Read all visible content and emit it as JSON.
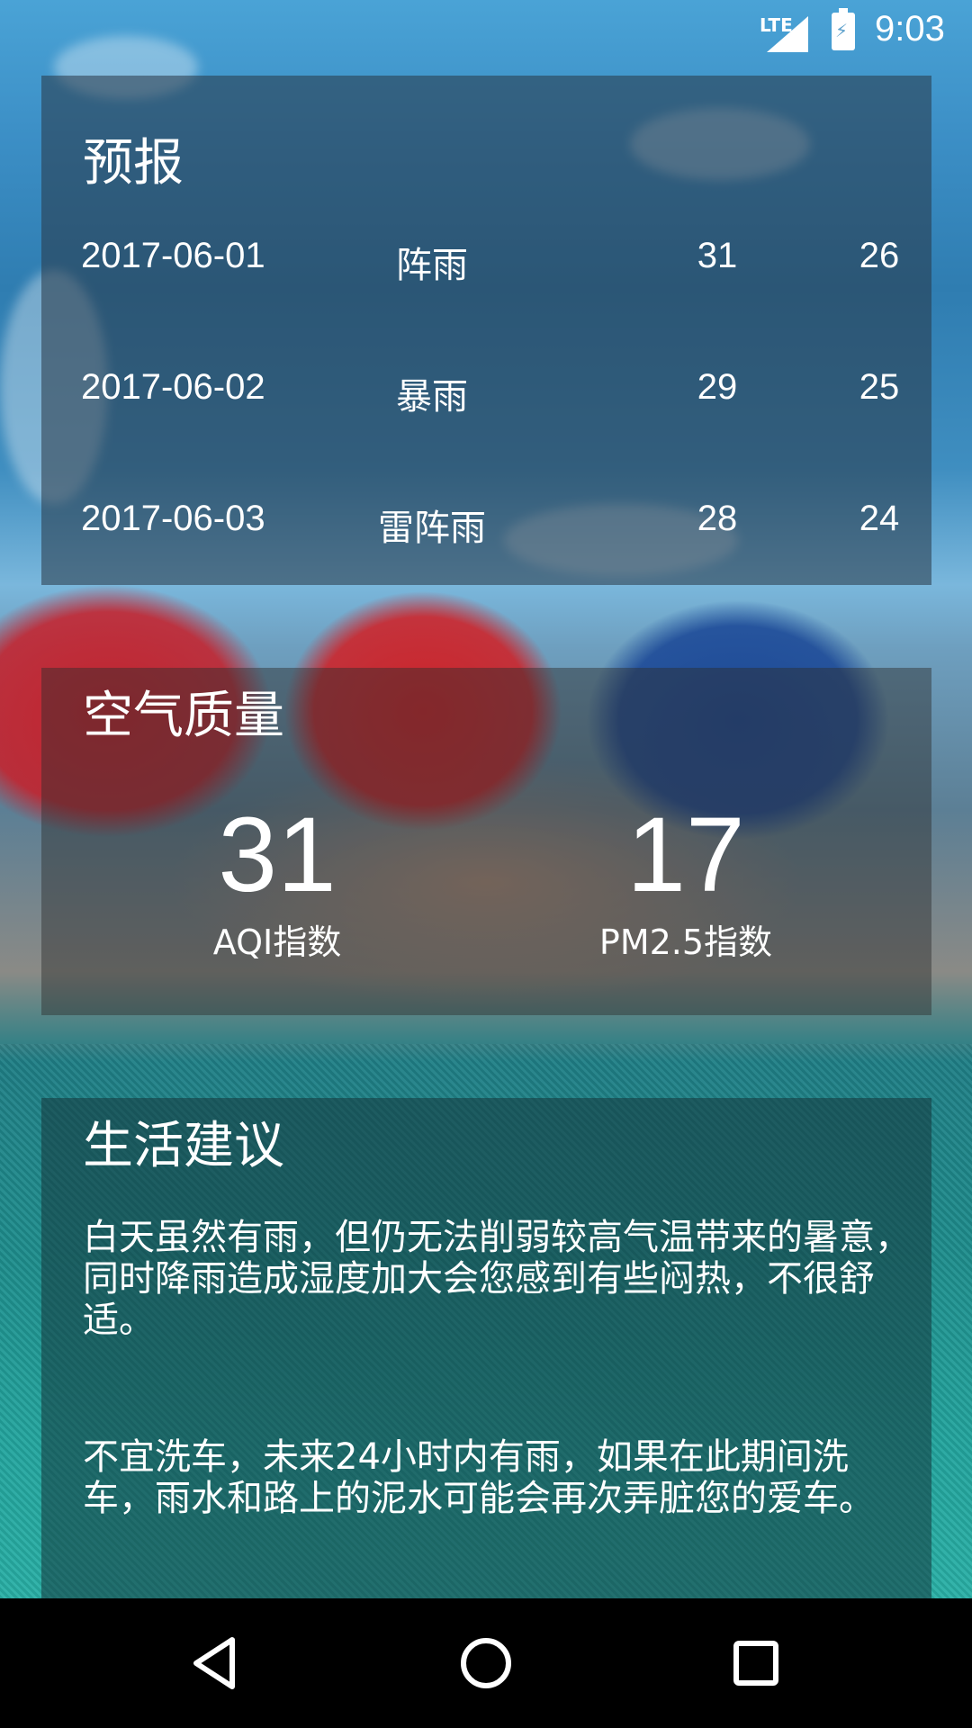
{
  "status_bar": {
    "network": "LTE",
    "time": "9:03"
  },
  "forecast": {
    "title": "预报",
    "rows": [
      {
        "date": "2017-06-01",
        "weather": "阵雨",
        "high": "31",
        "low": "26"
      },
      {
        "date": "2017-06-02",
        "weather": "暴雨",
        "high": "29",
        "low": "25"
      },
      {
        "date": "2017-06-03",
        "weather": "雷阵雨",
        "high": "28",
        "low": "24"
      }
    ]
  },
  "air_quality": {
    "title": "空气质量",
    "aqi_value": "31",
    "aqi_label": "AQI指数",
    "pm25_value": "17",
    "pm25_label": "PM2.5指数"
  },
  "life_advice": {
    "title": "生活建议",
    "comfort": "白天虽然有雨，但仍无法削弱较高气温带来的暑意，同时降雨造成湿度加大会您感到有些闷热，不很舒适。",
    "car_wash": "不宜洗车，未来24小时内有雨，如果在此期间洗车，雨水和路上的泥水可能会再次弄脏您的爱车。"
  },
  "nav_bar": {
    "icons": [
      "back-icon",
      "home-icon",
      "recent-apps-icon"
    ]
  }
}
